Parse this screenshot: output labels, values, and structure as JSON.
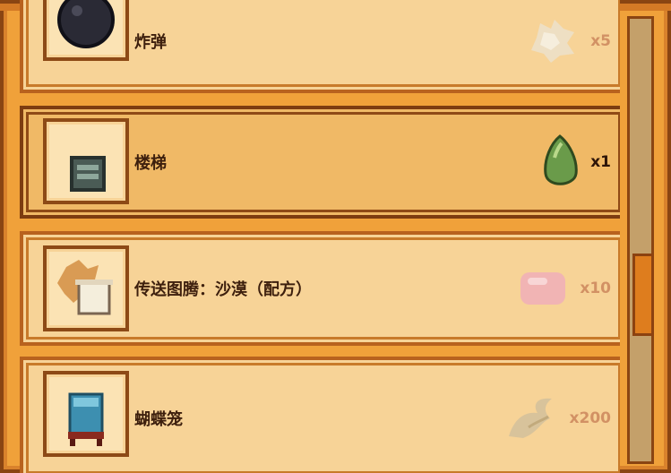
{
  "shop": {
    "items": [
      {
        "name": "炸弹",
        "icon": "bomb-icon",
        "cost_icon": "quartz-icon",
        "quantity": "x5",
        "affordable": false
      },
      {
        "name": "楼梯",
        "icon": "staircase-icon",
        "cost_icon": "jade-icon",
        "quantity": "x1",
        "affordable": true,
        "selected": true
      },
      {
        "name": "传送图腾：沙漠（配方）",
        "icon": "warp-totem-recipe-icon",
        "cost_icon": "soap-icon",
        "quantity": "x10",
        "affordable": false
      },
      {
        "name": "蝴蝶笼",
        "icon": "butterfly-hutch-icon",
        "cost_icon": "fiber-icon",
        "quantity": "x200",
        "affordable": false
      }
    ]
  },
  "scroll": {
    "position_fraction": 0.58
  },
  "colors": {
    "panel": "#f7d397",
    "selected_row": "#f0b966",
    "border": "#8d4a16",
    "frame": "#f0a13a",
    "text": "#3d1f0d",
    "dim_text": "#d29164"
  }
}
